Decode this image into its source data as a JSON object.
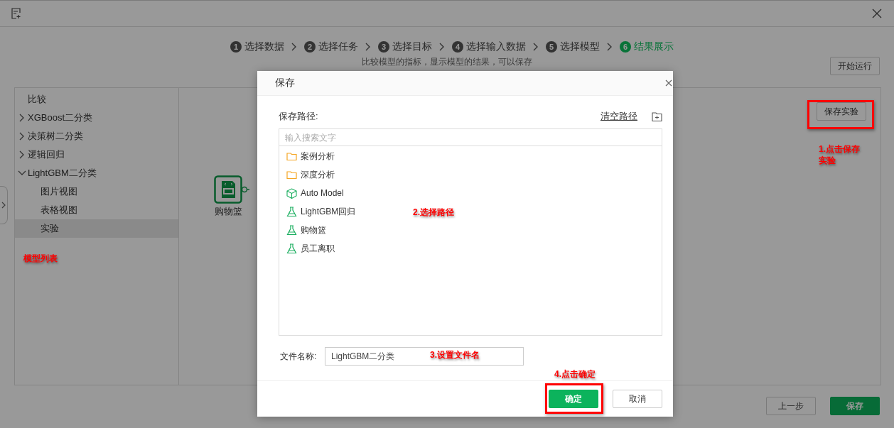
{
  "steps": [
    {
      "number": "1",
      "label": "选择数据",
      "selected": false
    },
    {
      "number": "2",
      "label": "选择任务",
      "selected": false
    },
    {
      "number": "3",
      "label": "选择目标",
      "selected": false
    },
    {
      "number": "4",
      "label": "选择输入数据",
      "selected": false
    },
    {
      "number": "5",
      "label": "选择模型",
      "selected": false
    },
    {
      "number": "6",
      "label": "结果展示",
      "selected": true
    }
  ],
  "subtitle": "比较模型的指标，显示模型的结果，可以保存",
  "run_button": "开始运行",
  "model_tree": [
    {
      "label": "比较",
      "kind": "leaf",
      "selected": false
    },
    {
      "label": "XGBoost二分类",
      "kind": "group",
      "expanded": false,
      "selected": false
    },
    {
      "label": "决策树二分类",
      "kind": "group",
      "expanded": false,
      "selected": false
    },
    {
      "label": "逻辑回归",
      "kind": "group",
      "expanded": false,
      "selected": false
    },
    {
      "label": "LightGBM二分类",
      "kind": "group",
      "expanded": true,
      "selected": false,
      "children": [
        {
          "label": "图片视图",
          "selected": false
        },
        {
          "label": "表格视图",
          "selected": false
        },
        {
          "label": "实验",
          "selected": true
        }
      ]
    }
  ],
  "canvas": {
    "save_button": "保存实验",
    "nodes": [
      {
        "label": "购物篮"
      }
    ]
  },
  "footer_buttons": [
    {
      "label": "上一步",
      "kind": "secondary"
    },
    {
      "label": "保存",
      "kind": "primary"
    }
  ],
  "dialog": {
    "title": "保存",
    "path_label": "保存路径:",
    "clear_link": "清空路径",
    "search": {
      "placeholder": "输入搜索文字"
    },
    "items": [
      {
        "label": "案例分析",
        "kind": "folder"
      },
      {
        "label": "深度分析",
        "kind": "folder"
      },
      {
        "label": "Auto Model",
        "kind": "model"
      },
      {
        "label": "LightGBM回归",
        "kind": "experiment"
      },
      {
        "label": "购物篮",
        "kind": "experiment"
      },
      {
        "label": "员工离职",
        "kind": "experiment"
      }
    ],
    "file_name_label": "文件名称:",
    "file_name_value": "LightGBM二分类",
    "buttons": [
      {
        "label": "确定",
        "kind": "primary"
      },
      {
        "label": "取消",
        "kind": "secondary"
      }
    ]
  },
  "annotations": [
    {
      "text": "1.点击保存实验"
    },
    {
      "text": "2.选择路径"
    },
    {
      "text": "3.设置文件名"
    },
    {
      "text": "4.点击确定"
    },
    {
      "text": "模型列表"
    }
  ]
}
